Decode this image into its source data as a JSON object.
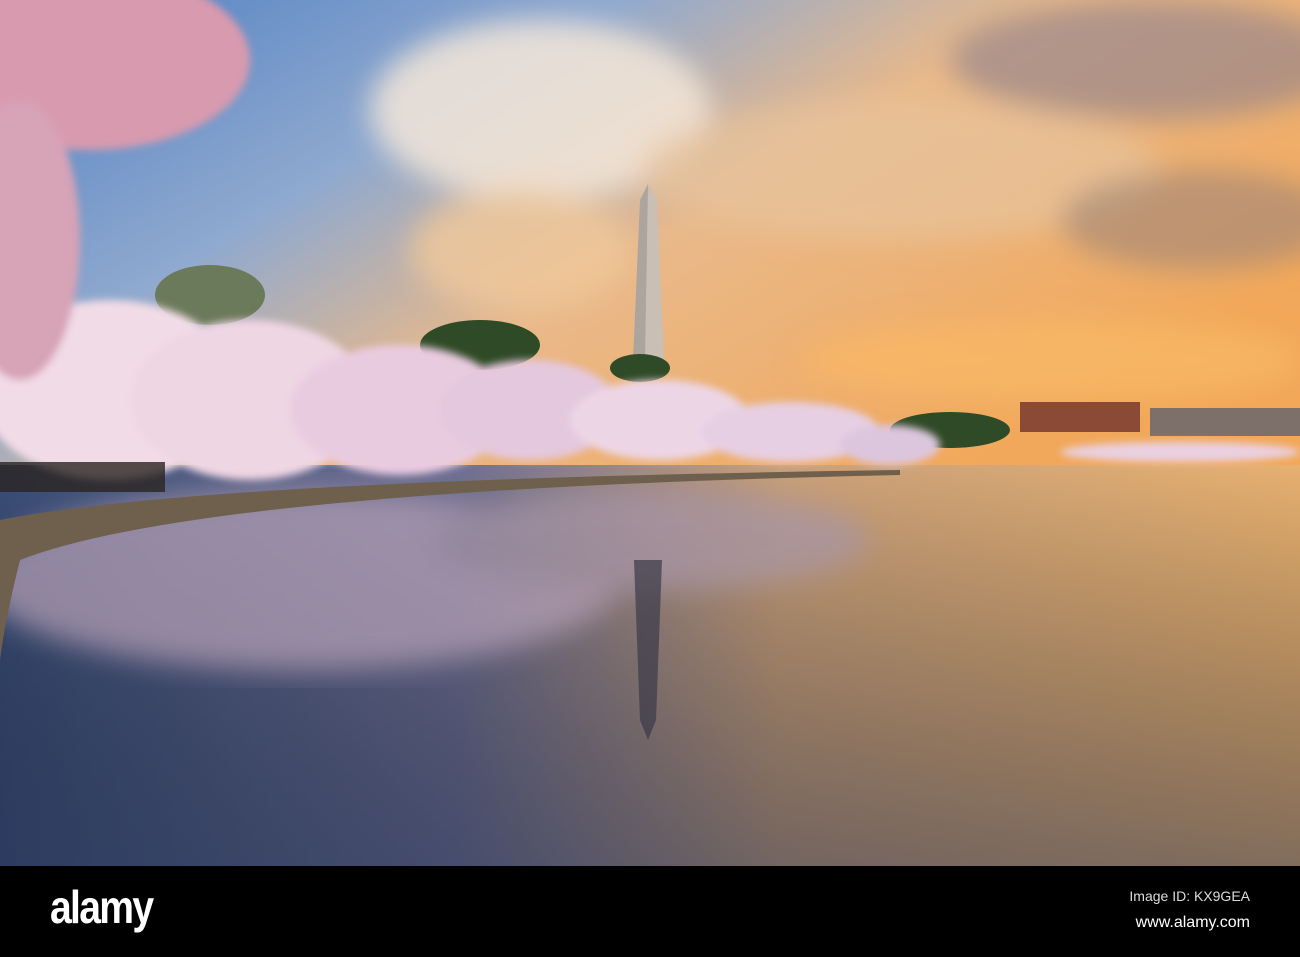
{
  "watermark": {
    "logo": "alamy",
    "image_id": "Image ID: KX9GEA",
    "url": "www.alamy.com"
  }
}
